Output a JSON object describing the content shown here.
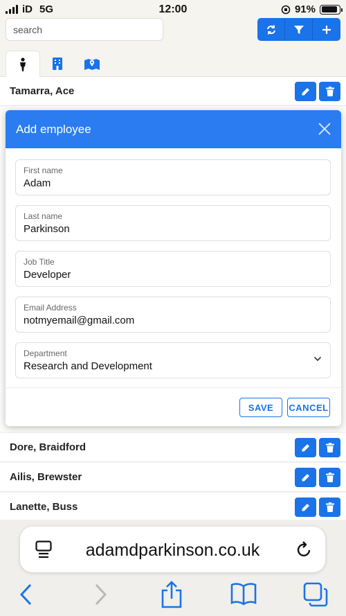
{
  "status_bar": {
    "carrier": "iD",
    "network": "5G",
    "time": "12:00",
    "battery": "91%",
    "battery_level": 0.91
  },
  "toolbar": {
    "search_placeholder": "search",
    "buttons": [
      "refresh-icon",
      "filter-icon",
      "plus-icon"
    ]
  },
  "tabs": [
    {
      "icon": "person-icon",
      "active": true
    },
    {
      "icon": "building-icon",
      "active": false
    },
    {
      "icon": "map-icon",
      "active": false
    }
  ],
  "rows_above": [
    {
      "name": "Tamarra, Ace"
    }
  ],
  "rows_below": [
    {
      "name": "Dore, Braidford"
    },
    {
      "name": "Ailis, Brewster"
    },
    {
      "name": "Lanette, Buss"
    }
  ],
  "modal": {
    "title": "Add employee",
    "fields": [
      {
        "label": "First name",
        "value": "Adam"
      },
      {
        "label": "Last name",
        "value": "Parkinson"
      },
      {
        "label": "Job Title",
        "value": "Developer"
      },
      {
        "label": "Email Address",
        "value": "notmyemail@gmail.com"
      },
      {
        "label": "Department",
        "value": "Research and Development"
      }
    ],
    "save_label": "SAVE",
    "cancel_label": "CANCEL"
  },
  "browser": {
    "url": "adamdparkinson.co.uk"
  },
  "colors": {
    "primary": "#1a73e8",
    "header": "#2a7cf0"
  }
}
